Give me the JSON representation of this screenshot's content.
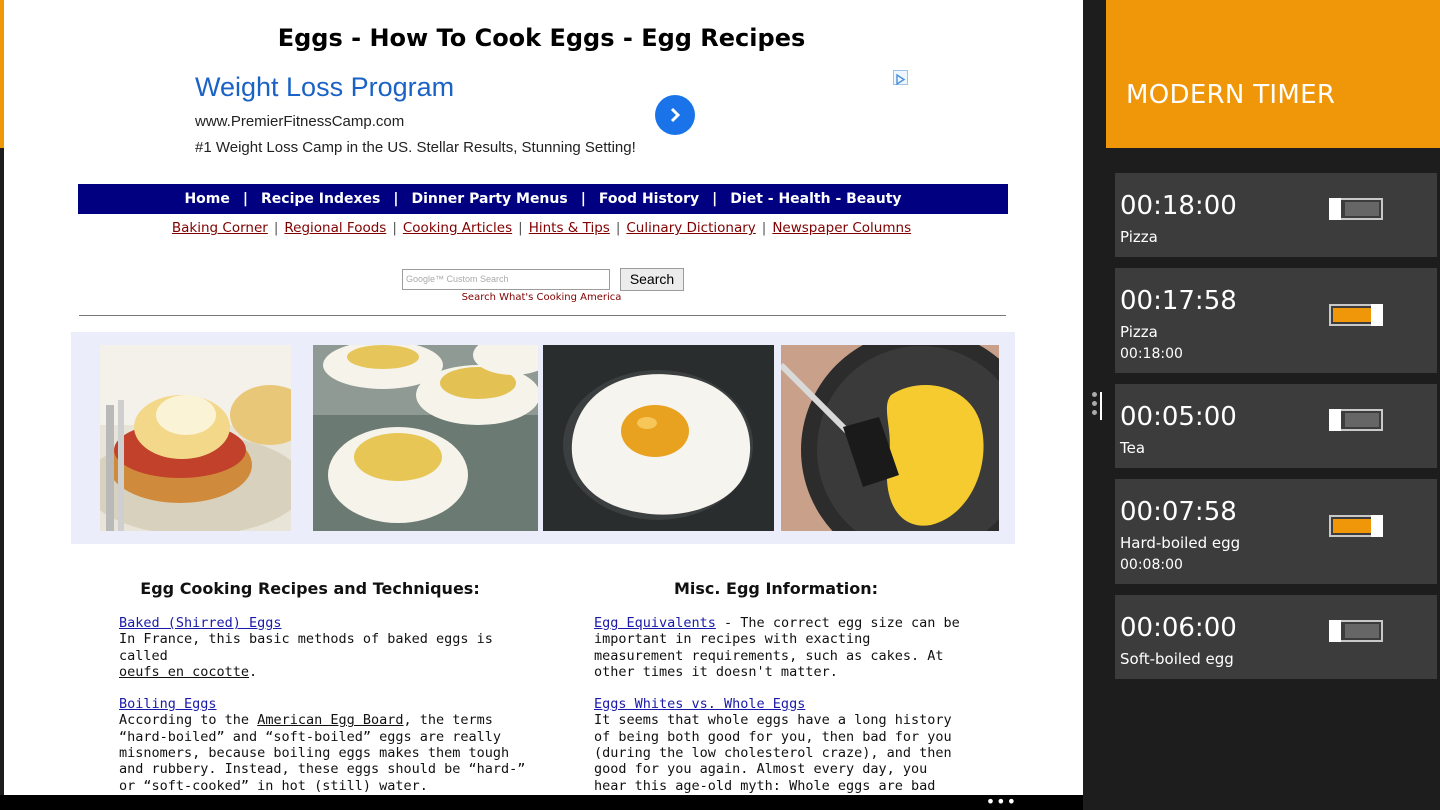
{
  "web": {
    "title": "Eggs - How To Cook Eggs - Egg Recipes",
    "ad": {
      "title": "Weight Loss Program",
      "url": "www.PremierFitnessCamp.com",
      "description": "#1 Weight Loss Camp in the US. Stellar Results, Stunning Setting!"
    },
    "nav": [
      "Home",
      "Recipe Indexes",
      "Dinner Party Menus",
      "Food History",
      "Diet - Health - Beauty"
    ],
    "nav_separator": "|",
    "sublinks": [
      "Baking Corner",
      "Regional Foods",
      "Cooking Articles",
      "Hints & Tips",
      "Culinary Dictionary",
      "Newspaper Columns"
    ],
    "search": {
      "placeholder": "Google™ Custom Search",
      "button": "Search",
      "caption": "Search What's Cooking America"
    },
    "photos": [
      "eggs-benedict-photo",
      "deviled-eggs-photo",
      "fried-egg-photo",
      "scrambled-eggs-photo"
    ],
    "left_column": {
      "heading": "Egg Cooking Recipes and Techniques:",
      "item1_link": "Baked (Shirred) Eggs",
      "item1_text_a": "In France, this basic methods of baked eggs is called",
      "item1_text_b": "oeufs en cocotte",
      "item1_text_c": ".",
      "item2_link": "Boiling Eggs",
      "item2_text_a": "According to the",
      "item2_text_b": "American Egg Board",
      "item2_text_c": ", the terms “hard-boiled” and “soft-boiled” eggs are really misnomers, because boiling eggs makes them tough and rubbery. Instead, these eggs should be “hard-” or “soft-cooked” in hot (still) water."
    },
    "right_column": {
      "heading": "Misc. Egg Information:",
      "item1_link": "Egg Equivalents",
      "item1_text": " - The correct egg size can be important in recipes with exacting measurement requirements, such as cakes. At other times it doesn't matter.",
      "item2_link": "Eggs Whites vs. Whole Eggs",
      "item2_text": "It seems that whole eggs have a long history of being both good for you, then bad for you (during the low cholesterol craze), and then good for you again. Almost every day, you hear this age-old myth: Whole eggs are bad for you because they"
    },
    "appbar_more": "•••"
  },
  "timer_app": {
    "title": "MODERN TIMER",
    "accent_color": "#f09609",
    "timers": [
      {
        "time": "00:18:00",
        "label": "Pizza",
        "original": "",
        "running": false,
        "progress": 0
      },
      {
        "time": "00:17:58",
        "label": "Pizza",
        "original": "00:18:00",
        "running": true,
        "progress": 1
      },
      {
        "time": "00:05:00",
        "label": "Tea",
        "original": "",
        "running": false,
        "progress": 0
      },
      {
        "time": "00:07:58",
        "label": "Hard-boiled egg",
        "original": "00:08:00",
        "running": true,
        "progress": 1
      },
      {
        "time": "00:06:00",
        "label": "Soft-boiled egg",
        "original": "",
        "running": false,
        "progress": 0
      }
    ]
  }
}
